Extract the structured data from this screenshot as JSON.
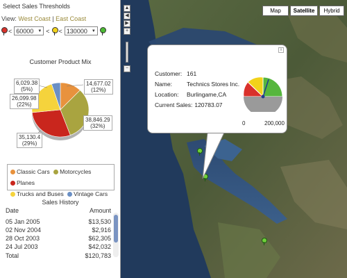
{
  "panel": {
    "title": "Select Sales Thresholds",
    "view_label": "View:",
    "west_coast": "West Coast",
    "separator": "|",
    "east_coast": "East Coast",
    "threshold_low": "60000",
    "threshold_high": "130000",
    "lt1": "<",
    "lt2": "<",
    "lt3": "<"
  },
  "product_mix": {
    "title": "Customer Product Mix",
    "slice_labels": [
      {
        "value": "6,029.38",
        "pct": "(5%)"
      },
      {
        "value": "26,099.98",
        "pct": "(22%)"
      },
      {
        "value": "35,130.4",
        "pct": "(29%)"
      },
      {
        "value": "14,677.02",
        "pct": "(12%)"
      },
      {
        "value": "38,846.29",
        "pct": "(32%)"
      }
    ]
  },
  "chart_data": {
    "type": "pie",
    "title": "Customer Product Mix",
    "categories": [
      "Classic Cars",
      "Motorcycles",
      "Planes",
      "Trucks and Buses",
      "Vintage Cars"
    ],
    "values": [
      14677.02,
      38846.29,
      35130.4,
      26099.98,
      6029.38
    ],
    "colors": [
      "#e8923d",
      "#a9a440",
      "#c9261d",
      "#f5d33c",
      "#6a8fc4"
    ]
  },
  "legend": [
    {
      "label": "Classic Cars",
      "color": "#e8923d"
    },
    {
      "label": "Motorcycles",
      "color": "#a9a440"
    },
    {
      "label": "Planes",
      "color": "#c9261d"
    },
    {
      "label": "Trucks and Buses",
      "color": "#f5d33c"
    },
    {
      "label": "Vintage Cars",
      "color": "#6a8fc4"
    }
  ],
  "history": {
    "title": "Sales History",
    "col_date": "Date",
    "col_amount": "Amount",
    "rows": [
      {
        "date": "05 Jan 2005",
        "amount": "$13,530"
      },
      {
        "date": "02 Nov 2004",
        "amount": "$2,916"
      },
      {
        "date": "28 Oct 2003",
        "amount": "$62,305"
      },
      {
        "date": "24 Jul 2003",
        "amount": "$42,032"
      }
    ],
    "total_label": "Total",
    "total_amount": "$120,783"
  },
  "map": {
    "btn_map": "Map",
    "btn_satellite": "Satellite",
    "btn_hybrid": "Hybrid",
    "active_type": "Satellite"
  },
  "info": {
    "customer_label": "Customer:",
    "customer": "161",
    "name_label": "Name:",
    "name": "Technics Stores Inc.",
    "location_label": "Location:",
    "location": "Burlingame,CA",
    "sales_label": "Current Sales:",
    "sales": "120783.07",
    "gauge_min": "0",
    "gauge_max": "200,000",
    "gauge_fraction": 0.6
  }
}
